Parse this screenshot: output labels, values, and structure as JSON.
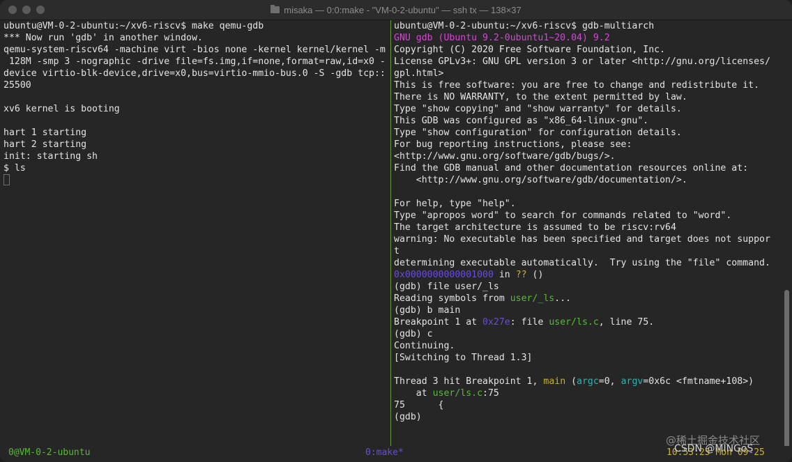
{
  "window": {
    "title": "misaka — 0:0:make - \"VM-0-2-ubuntu\" — ssh tx — 138×37"
  },
  "left_pane": {
    "lines": [
      "ubuntu@VM-0-2-ubuntu:~/xv6-riscv$ make qemu-gdb",
      "*** Now run 'gdb' in another window.",
      "qemu-system-riscv64 -machine virt -bios none -kernel kernel/kernel -m",
      " 128M -smp 3 -nographic -drive file=fs.img,if=none,format=raw,id=x0 -",
      "device virtio-blk-device,drive=x0,bus=virtio-mmio-bus.0 -S -gdb tcp::",
      "25500",
      "",
      "xv6 kernel is booting",
      "",
      "hart 1 starting",
      "hart 2 starting",
      "init: starting sh",
      "$ ls"
    ]
  },
  "right_pane": {
    "l1": "ubuntu@VM-0-2-ubuntu:~/xv6-riscv$ gdb-multiarch",
    "l2": "GNU gdb (Ubuntu 9.2-0ubuntu1~20.04) 9.2",
    "l3": "Copyright (C) 2020 Free Software Foundation, Inc.",
    "l4": "License GPLv3+: GNU GPL version 3 or later <http://gnu.org/licenses/",
    "l5": "gpl.html>",
    "l6": "This is free software: you are free to change and redistribute it.",
    "l7": "There is NO WARRANTY, to the extent permitted by law.",
    "l8": "Type \"show copying\" and \"show warranty\" for details.",
    "l9": "This GDB was configured as \"x86_64-linux-gnu\".",
    "l10": "Type \"show configuration\" for configuration details.",
    "l11": "For bug reporting instructions, please see:",
    "l12": "<http://www.gnu.org/software/gdb/bugs/>.",
    "l13": "Find the GDB manual and other documentation resources online at:",
    "l14": "    <http://www.gnu.org/software/gdb/documentation/>.",
    "l15": "",
    "l16": "For help, type \"help\".",
    "l17": "Type \"apropos word\" to search for commands related to \"word\".",
    "l18": "The target architecture is assumed to be riscv:rv64",
    "l19": "warning: No executable has been specified and target does not suppor",
    "l20": "t",
    "l21": "determining executable automatically.  Try using the \"file\" command.",
    "l22_addr": "0x0000000000001000",
    "l22_in": " in ",
    "l22_q": "??",
    "l22_end": " ()",
    "l23": "(gdb) file user/_ls",
    "l24_a": "Reading symbols from ",
    "l24_b": "user/_ls",
    "l24_c": "...",
    "l25": "(gdb) b main",
    "l26_a": "Breakpoint 1 at ",
    "l26_b": "0x27e",
    "l26_c": ": file ",
    "l26_d": "user/ls.c",
    "l26_e": ", line 75.",
    "l27": "(gdb) c",
    "l28": "Continuing.",
    "l29": "[Switching to Thread 1.3]",
    "l30": "",
    "l31_a": "Thread 3 hit Breakpoint 1, ",
    "l31_b": "main",
    "l31_c": " (",
    "l31_d": "argc",
    "l31_e": "=0, ",
    "l31_f": "argv",
    "l31_g": "=0x6c <fmtname+108>)",
    "l32_a": "    at ",
    "l32_b": "user/ls.c",
    "l32_c": ":75",
    "l33": "75      {",
    "l34": "(gdb)"
  },
  "status": {
    "session": "0@VM-0-2-ubuntu",
    "window": "0:make*",
    "clock": "10:53:25 Mon 09-25"
  },
  "watermark": {
    "site": "@稀土掘金技术社区",
    "author": "CSDN @MINGoS"
  },
  "colors": {
    "prompt_green": "#5ab83a",
    "gdb_banner_magenta": "#d04ad4",
    "address_blue": "#6a4cd8",
    "function_yellow": "#c9b12e",
    "arg_cyan": "#2fb3b3"
  }
}
